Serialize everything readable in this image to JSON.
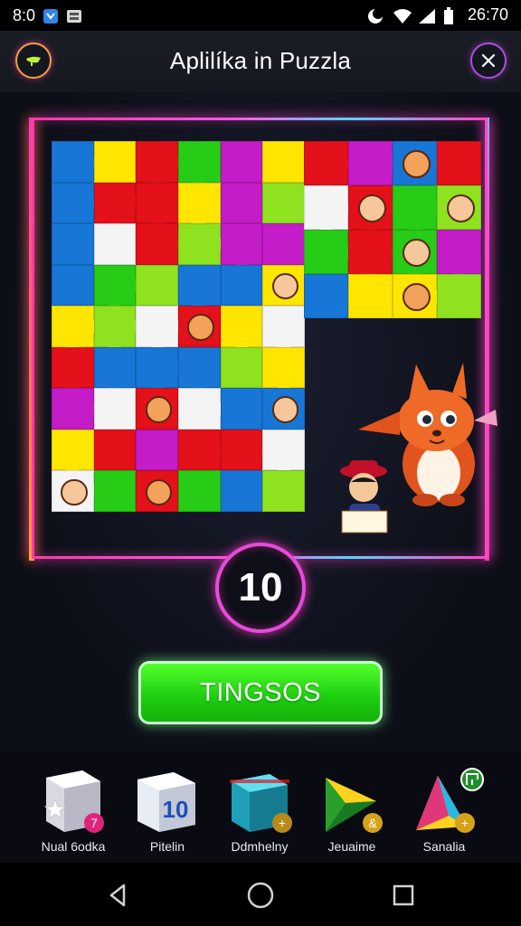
{
  "status_bar": {
    "time_left": "8:0",
    "time_right": "26:70",
    "icons": [
      "notification-icon",
      "media-icon",
      "moon-icon",
      "wifi-icon",
      "signal-icon",
      "battery-icon"
    ]
  },
  "header": {
    "title": "Aplilíka in Puzzla",
    "back_icon": "back-icon",
    "close_icon": "close-icon"
  },
  "game": {
    "score": "10",
    "play_label": "TINGSOS",
    "colors": {
      "red": "#e4101a",
      "yellow": "#ffe600",
      "green": "#27cc17",
      "blue": "#1776d6",
      "magenta": "#c41cc6",
      "white": "#f4f4f4",
      "lime": "#8ee21f"
    }
  },
  "tools": [
    {
      "label": "Nual 6odka",
      "icon": "star-cube-icon"
    },
    {
      "label": "Pitelin",
      "icon": "number-cube-icon",
      "badge_text": "10"
    },
    {
      "label": "Ddmhelny",
      "icon": "teal-cube-icon"
    },
    {
      "label": "Jeuaime",
      "icon": "green-pyramid-icon"
    },
    {
      "label": "Sanalia",
      "icon": "prism-icon"
    }
  ],
  "nav": {
    "back": "back-nav-icon",
    "home": "home-nav-icon",
    "recents": "recents-nav-icon"
  }
}
